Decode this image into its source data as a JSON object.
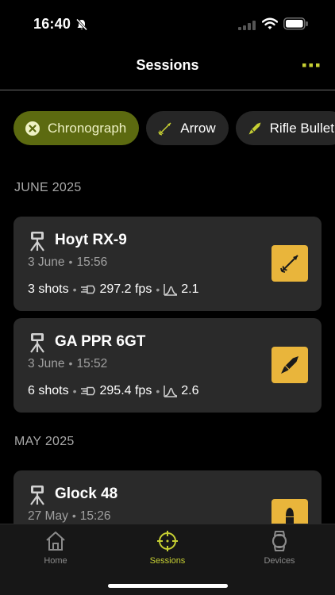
{
  "status": {
    "time": "16:40"
  },
  "nav": {
    "title": "Sessions"
  },
  "filters": [
    {
      "label": "Chronograph",
      "icon": "close-circle-icon",
      "selected": true
    },
    {
      "label": "Arrow",
      "icon": "arrow-icon",
      "selected": false
    },
    {
      "label": "Rifle Bullet",
      "icon": "rifle-bullet-icon",
      "selected": false
    }
  ],
  "sections": [
    {
      "month": "JUNE 2025",
      "sessions": [
        {
          "name": "Hoyt RX-9",
          "date": "3 June",
          "time": "15:56",
          "shots": "3 shots",
          "speed": "297.2 fps",
          "spread": "2.1",
          "type_icon": "arrow-icon"
        },
        {
          "name": "GA PPR 6GT",
          "date": "3 June",
          "time": "15:52",
          "shots": "6 shots",
          "speed": "295.4 fps",
          "spread": "2.6",
          "type_icon": "rifle-bullet-icon"
        }
      ]
    },
    {
      "month": "MAY 2025",
      "sessions": [
        {
          "name": "Glock 48",
          "date": "27 May",
          "time": "15:26",
          "type_icon": "pistol-bullet-icon"
        }
      ]
    }
  ],
  "tabs": [
    {
      "label": "Home",
      "icon": "home-icon",
      "active": false
    },
    {
      "label": "Sessions",
      "icon": "crosshair-icon",
      "active": true
    },
    {
      "label": "Devices",
      "icon": "watch-icon",
      "active": false
    }
  ],
  "colors": {
    "accent": "#c6cf33",
    "chip_selected": "#5c6a10",
    "badge": "#e9b53b",
    "card": "#2a2a2a"
  }
}
